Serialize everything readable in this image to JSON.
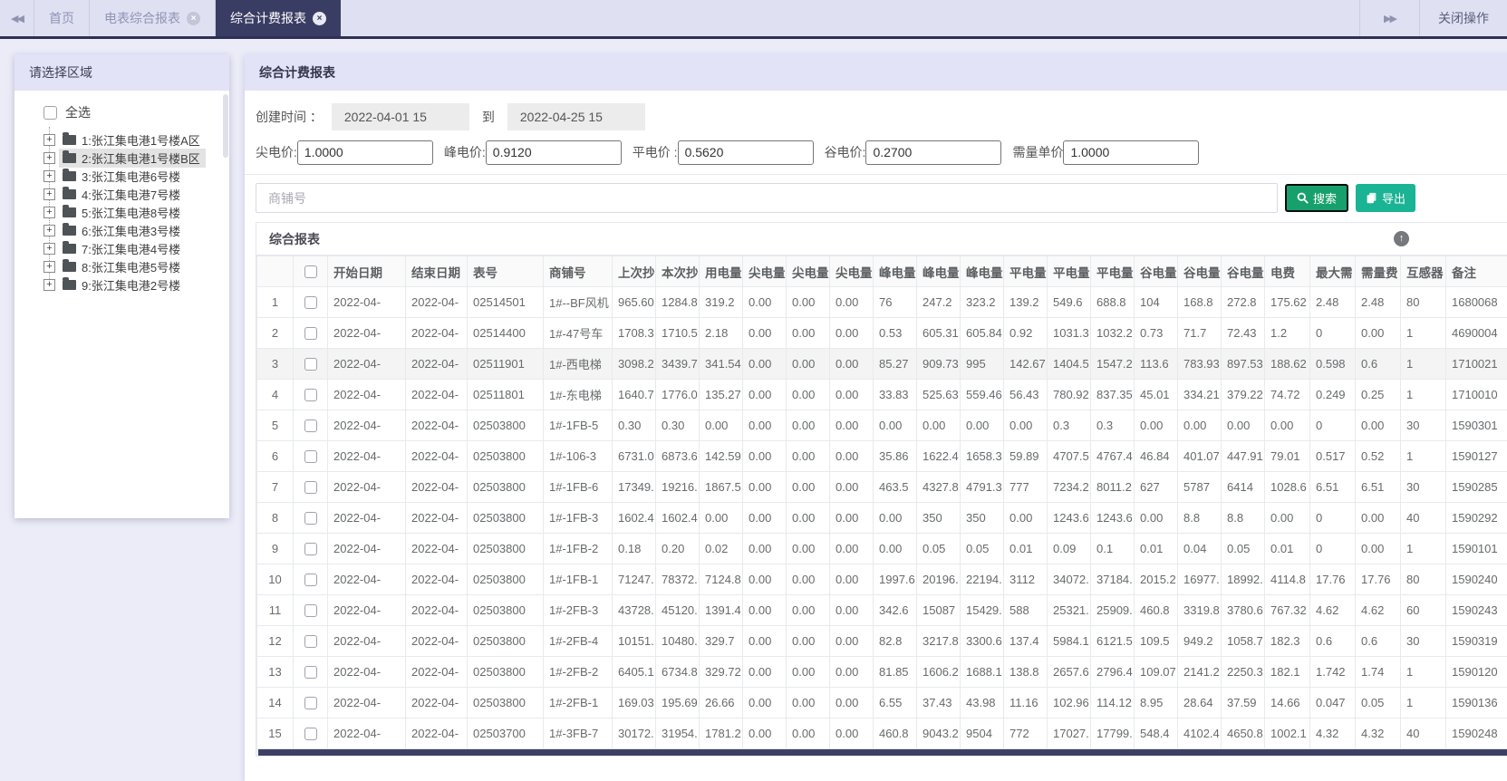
{
  "colors": {
    "tab_bar_bg": "#dfe1f2",
    "active_tab": "#3a3d63",
    "panel_header_bg": "#e2e3f6",
    "search_button": "#18a06c",
    "export_button": "#1ab394",
    "scrollbar_thumb": "#3d4066"
  },
  "icons": {
    "back": "◀◀",
    "forward": "▶▶",
    "close": "×",
    "collapse": "↑"
  },
  "tab_bar": {
    "tabs": [
      {
        "label": "首页",
        "closable": false,
        "active": false
      },
      {
        "label": "电表综合报表",
        "closable": true,
        "active": false
      },
      {
        "label": "综合计费报表",
        "closable": true,
        "active": true
      }
    ],
    "close_ops_label": "关闭操作"
  },
  "sidebar": {
    "title": "请选择区域",
    "select_all_label": "全选",
    "tree_items": [
      {
        "label": "1:张江集电港1号楼A区",
        "selected": false
      },
      {
        "label": "2:张江集电港1号楼B区",
        "selected": true
      },
      {
        "label": "3:张江集电港6号楼",
        "selected": false
      },
      {
        "label": "4:张江集电港7号楼",
        "selected": false
      },
      {
        "label": "5:张江集电港8号楼",
        "selected": false
      },
      {
        "label": "6:张江集电港3号楼",
        "selected": false
      },
      {
        "label": "7:张江集电港4号楼",
        "selected": false
      },
      {
        "label": "8:张江集电港5号楼",
        "selected": false
      },
      {
        "label": "9:张江集电港2号楼",
        "selected": false
      }
    ]
  },
  "report": {
    "title": "综合计费报表",
    "filters": {
      "created_label": "创建时间 ：",
      "date_from": "2022-04-01 15",
      "to_label": "到",
      "date_to": "2022-04-25 15",
      "prices": [
        {
          "label": "尖电价:",
          "value": "1.0000"
        },
        {
          "label": "峰电价:",
          "value": "0.9120"
        },
        {
          "label": "平电价 :",
          "value": "0.5620"
        },
        {
          "label": "谷电价:",
          "value": "0.2700"
        },
        {
          "label": "需量单价",
          "value": "1.0000"
        }
      ],
      "shop_placeholder": "商铺号",
      "search_label": "搜索",
      "export_label": "导出"
    },
    "table": {
      "title": "综合报表",
      "columns": [
        "开始日期",
        "结束日期",
        "表号",
        "商铺号",
        "上次抄",
        "本次抄",
        "用电量",
        "尖电量",
        "尖电量",
        "尖电量",
        "峰电量",
        "峰电量",
        "峰电量",
        "平电量",
        "平电量",
        "平电量",
        "谷电量",
        "谷电量",
        "谷电量",
        "电费",
        "最大需",
        "需量费",
        "互感器",
        "备注"
      ],
      "rows": [
        {
          "n": "1",
          "highlight": false,
          "cells": [
            "2022-04-",
            "2022-04-",
            "02514501",
            "1#--BF风机",
            "965.60",
            "1284.8",
            "319.2",
            "0.00",
            "0.00",
            "0.00",
            "76",
            "247.2",
            "323.2",
            "139.2",
            "549.6",
            "688.8",
            "104",
            "168.8",
            "272.8",
            "175.62",
            "2.48",
            "2.48",
            "80",
            "1680068"
          ]
        },
        {
          "n": "2",
          "highlight": false,
          "cells": [
            "2022-04-",
            "2022-04-",
            "02514400",
            "1#-47号车",
            "1708.3",
            "1710.5",
            "2.18",
            "0.00",
            "0.00",
            "0.00",
            "0.53",
            "605.31",
            "605.84",
            "0.92",
            "1031.3",
            "1032.2",
            "0.73",
            "71.7",
            "72.43",
            "1.2",
            "0",
            "0.00",
            "1",
            "4690004"
          ]
        },
        {
          "n": "3",
          "highlight": true,
          "cells": [
            "2022-04-",
            "2022-04-",
            "02511901",
            "1#-西电梯",
            "3098.2",
            "3439.7",
            "341.54",
            "0.00",
            "0.00",
            "0.00",
            "85.27",
            "909.73",
            "995",
            "142.67",
            "1404.5",
            "1547.2",
            "113.6",
            "783.93",
            "897.53",
            "188.62",
            "0.598",
            "0.6",
            "1",
            "1710021"
          ]
        },
        {
          "n": "4",
          "highlight": false,
          "cells": [
            "2022-04-",
            "2022-04-",
            "02511801",
            "1#-东电梯",
            "1640.7",
            "1776.0",
            "135.27",
            "0.00",
            "0.00",
            "0.00",
            "33.83",
            "525.63",
            "559.46",
            "56.43",
            "780.92",
            "837.35",
            "45.01",
            "334.21",
            "379.22",
            "74.72",
            "0.249",
            "0.25",
            "1",
            "1710010"
          ]
        },
        {
          "n": "5",
          "highlight": false,
          "cells": [
            "2022-04-",
            "2022-04-",
            "02503800",
            "1#-1FB-5",
            "0.30",
            "0.30",
            "0.00",
            "0.00",
            "0.00",
            "0.00",
            "0.00",
            "0.00",
            "0.00",
            "0.00",
            "0.3",
            "0.3",
            "0.00",
            "0.00",
            "0.00",
            "0.00",
            "0",
            "0.00",
            "30",
            "1590301"
          ]
        },
        {
          "n": "6",
          "highlight": false,
          "cells": [
            "2022-04-",
            "2022-04-",
            "02503800",
            "1#-106-3",
            "6731.0",
            "6873.6",
            "142.59",
            "0.00",
            "0.00",
            "0.00",
            "35.86",
            "1622.4",
            "1658.3",
            "59.89",
            "4707.5",
            "4767.4",
            "46.84",
            "401.07",
            "447.91",
            "79.01",
            "0.517",
            "0.52",
            "1",
            "1590127"
          ]
        },
        {
          "n": "7",
          "highlight": false,
          "cells": [
            "2022-04-",
            "2022-04-",
            "02503800",
            "1#-1FB-6",
            "17349.",
            "19216.",
            "1867.5",
            "0.00",
            "0.00",
            "0.00",
            "463.5",
            "4327.8",
            "4791.3",
            "777",
            "7234.2",
            "8011.2",
            "627",
            "5787",
            "6414",
            "1028.6",
            "6.51",
            "6.51",
            "30",
            "1590285"
          ]
        },
        {
          "n": "8",
          "highlight": false,
          "cells": [
            "2022-04-",
            "2022-04-",
            "02503800",
            "1#-1FB-3",
            "1602.4",
            "1602.4",
            "0.00",
            "0.00",
            "0.00",
            "0.00",
            "0.00",
            "350",
            "350",
            "0.00",
            "1243.6",
            "1243.6",
            "0.00",
            "8.8",
            "8.8",
            "0.00",
            "0",
            "0.00",
            "40",
            "1590292"
          ]
        },
        {
          "n": "9",
          "highlight": false,
          "cells": [
            "2022-04-",
            "2022-04-",
            "02503800",
            "1#-1FB-2",
            "0.18",
            "0.20",
            "0.02",
            "0.00",
            "0.00",
            "0.00",
            "0.00",
            "0.05",
            "0.05",
            "0.01",
            "0.09",
            "0.1",
            "0.01",
            "0.04",
            "0.05",
            "0.01",
            "0",
            "0.00",
            "1",
            "1590101"
          ]
        },
        {
          "n": "10",
          "highlight": false,
          "cells": [
            "2022-04-",
            "2022-04-",
            "02503800",
            "1#-1FB-1",
            "71247.",
            "78372.",
            "7124.8",
            "0.00",
            "0.00",
            "0.00",
            "1997.6",
            "20196.",
            "22194.",
            "3112",
            "34072.",
            "37184.",
            "2015.2",
            "16977.",
            "18992.",
            "4114.8",
            "17.76",
            "17.76",
            "80",
            "1590240"
          ]
        },
        {
          "n": "11",
          "highlight": false,
          "cells": [
            "2022-04-",
            "2022-04-",
            "02503800",
            "1#-2FB-3",
            "43728.",
            "45120.",
            "1391.4",
            "0.00",
            "0.00",
            "0.00",
            "342.6",
            "15087",
            "15429.",
            "588",
            "25321.",
            "25909.",
            "460.8",
            "3319.8",
            "3780.6",
            "767.32",
            "4.62",
            "4.62",
            "60",
            "1590243"
          ]
        },
        {
          "n": "12",
          "highlight": false,
          "cells": [
            "2022-04-",
            "2022-04-",
            "02503800",
            "1#-2FB-4",
            "10151.",
            "10480.",
            "329.7",
            "0.00",
            "0.00",
            "0.00",
            "82.8",
            "3217.8",
            "3300.6",
            "137.4",
            "5984.1",
            "6121.5",
            "109.5",
            "949.2",
            "1058.7",
            "182.3",
            "0.6",
            "0.6",
            "30",
            "1590319"
          ]
        },
        {
          "n": "13",
          "highlight": false,
          "cells": [
            "2022-04-",
            "2022-04-",
            "02503800",
            "1#-2FB-2",
            "6405.1",
            "6734.8",
            "329.72",
            "0.00",
            "0.00",
            "0.00",
            "81.85",
            "1606.2",
            "1688.1",
            "138.8",
            "2657.6",
            "2796.4",
            "109.07",
            "2141.2",
            "2250.3",
            "182.1",
            "1.742",
            "1.74",
            "1",
            "1590120"
          ]
        },
        {
          "n": "14",
          "highlight": false,
          "cells": [
            "2022-04-",
            "2022-04-",
            "02503800",
            "1#-2FB-1",
            "169.03",
            "195.69",
            "26.66",
            "0.00",
            "0.00",
            "0.00",
            "6.55",
            "37.43",
            "43.98",
            "11.16",
            "102.96",
            "114.12",
            "8.95",
            "28.64",
            "37.59",
            "14.66",
            "0.047",
            "0.05",
            "1",
            "1590136"
          ]
        },
        {
          "n": "15",
          "highlight": false,
          "cells": [
            "2022-04-",
            "2022-04-",
            "02503700",
            "1#-3FB-7",
            "30172.",
            "31954.",
            "1781.2",
            "0.00",
            "0.00",
            "0.00",
            "460.8",
            "9043.2",
            "9504",
            "772",
            "17027.",
            "17799.",
            "548.4",
            "4102.4",
            "4650.8",
            "1002.1",
            "4.32",
            "4.32",
            "40",
            "1590248"
          ]
        }
      ]
    }
  }
}
